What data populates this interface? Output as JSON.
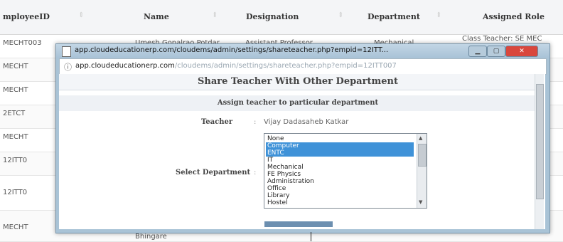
{
  "table": {
    "headers": [
      "mployeeID",
      "Name",
      "Designation",
      "Department",
      "Assigned Role"
    ],
    "rows": [
      {
        "id": "MECHT003",
        "name": "Umesh Gopalrao Potdar",
        "designation": "Assistant Professor",
        "department": "Mechanical",
        "role": "Class Teacher: SE MEC"
      },
      {
        "id": "MECHT",
        "name": "",
        "designation": "",
        "department": "",
        "role": ""
      },
      {
        "id": "MECHT",
        "name": "",
        "designation": "",
        "department": "",
        "role": ""
      },
      {
        "id": "2ETCT",
        "name": "",
        "designation": "",
        "department": "",
        "role": ""
      },
      {
        "id": "MECHT",
        "name": "",
        "designation": "",
        "department": "",
        "role": ""
      },
      {
        "id": "12ITT0",
        "name": "",
        "designation": "",
        "department": "",
        "role": ""
      },
      {
        "id": "12ITT0",
        "name": "",
        "designation": "",
        "department": "",
        "role": ""
      },
      {
        "id": "MECHT",
        "name": "Bhingare",
        "designation": "",
        "department": "",
        "role": ""
      }
    ]
  },
  "popup": {
    "window_title": "app.cloudeducationerp.com/cloudems/admin/settings/shareteacher.php?empid=12ITT...",
    "url_host": "app.cloudeducationerp.com",
    "url_path": "/cloudems/admin/settings/shareteacher.php?empid=12ITT007",
    "panel_title": "Share Teacher With Other Department",
    "subtitle": "Assign teacher to particular department",
    "teacher_label": "Teacher",
    "teacher_value": "Vijay Dadasaheb Katkar",
    "select_label": "Select Department",
    "colon": ":",
    "departments": [
      {
        "label": "None",
        "selected": false
      },
      {
        "label": "Computer",
        "selected": true
      },
      {
        "label": "ENTC",
        "selected": true
      },
      {
        "label": "IT",
        "selected": false
      },
      {
        "label": "Mechanical",
        "selected": false
      },
      {
        "label": "FE Physics",
        "selected": false
      },
      {
        "label": "Administration",
        "selected": false
      },
      {
        "label": "Office",
        "selected": false
      },
      {
        "label": "Library",
        "selected": false
      },
      {
        "label": "Hostel",
        "selected": false
      }
    ]
  },
  "colors": {
    "selection": "#3f92d8",
    "window_frame": "#a9c3d6",
    "close_button": "#d9473d"
  }
}
